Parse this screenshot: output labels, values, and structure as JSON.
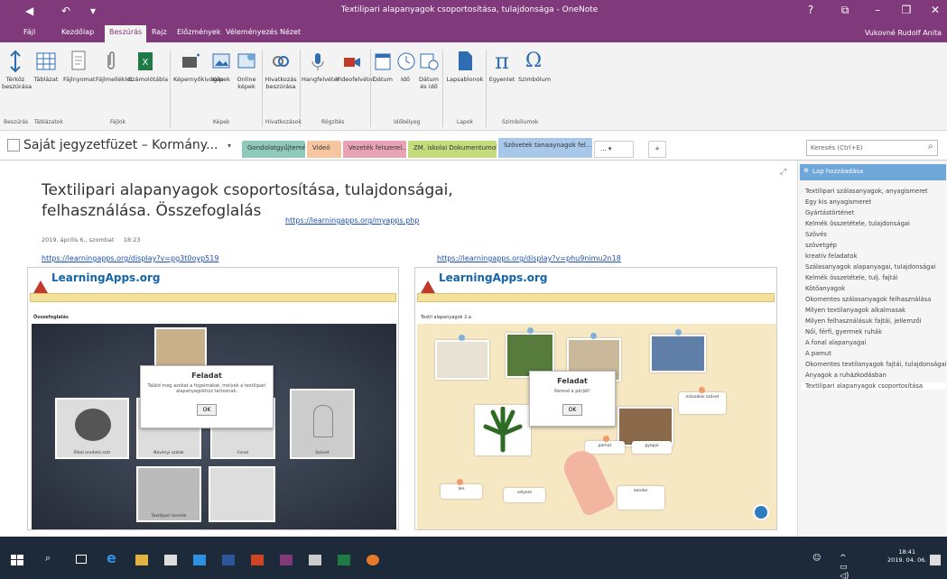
{
  "window": {
    "title": "Textilipari alapanyagok csoportosítása, tulajdonsága - OneNote",
    "controls": [
      "?",
      "⧉",
      "–",
      "❐",
      "✕"
    ]
  },
  "menu": {
    "tabs": [
      "Fájl",
      "Kezdőlap",
      "Beszúrás",
      "Rajz",
      "Előzmények",
      "Véleményezés",
      "Nézet"
    ],
    "active_index": 2,
    "user": "Vukovné Rudolf Anita"
  },
  "ribbon": {
    "buttons": [
      {
        "label": "Térköz beszúrása",
        "icon": "space-icon"
      },
      {
        "label": "Táblázat",
        "icon": "table-icon"
      },
      {
        "label": "Fájlnyomat",
        "icon": "file-printout-icon"
      },
      {
        "label": "Fájlmelléklet",
        "icon": "attachment-icon"
      },
      {
        "label": "Számolótábla",
        "icon": "spreadsheet-icon"
      },
      {
        "label": "Képernyőkivágás",
        "icon": "screen-clipping-icon"
      },
      {
        "label": "Képek",
        "icon": "pictures-icon"
      },
      {
        "label": "Online képek",
        "icon": "online-pictures-icon"
      },
      {
        "label": "Hivatkozás beszúrása",
        "icon": "link-icon"
      },
      {
        "label": "Hangfelvétel",
        "icon": "audio-icon"
      },
      {
        "label": "Videofelvétel",
        "icon": "video-icon"
      },
      {
        "label": "Dátum",
        "icon": "date-icon"
      },
      {
        "label": "Idő",
        "icon": "time-icon"
      },
      {
        "label": "Dátum és idő",
        "icon": "date-time-icon"
      },
      {
        "label": "Lapsablonok",
        "icon": "page-templates-icon"
      },
      {
        "label": "Egyenlet",
        "icon": "equation-icon"
      },
      {
        "label": "Szimbólum",
        "icon": "symbol-icon"
      }
    ],
    "groups": [
      "Beszúrás",
      "Táblázatok",
      "Fájlok",
      "Képek",
      "Hivatkozások",
      "Rögzítés",
      "Időbélyeg",
      "Lapok",
      "Szimbólumok"
    ]
  },
  "notebook": {
    "title": "Saját jegyzetfüzet – Kormány...",
    "sections": [
      {
        "label": "Gondolatgyűjtemény",
        "color": "#8fc9b9"
      },
      {
        "label": "Videó",
        "color": "#f6c6a0"
      },
      {
        "label": "Vezeték felszerel...",
        "color": "#e8a3b5"
      },
      {
        "label": "ZM. iskolai Dokumentumok",
        "color": "#c5dc7c"
      },
      {
        "label": "Szövetek tanaaynagok fel...",
        "color": "#a7c8e8"
      }
    ],
    "more_label": "...",
    "add_label": "+",
    "search_placeholder": "Keresés (Ctrl+E)"
  },
  "page": {
    "title_line1": "Textilipari alapanyagok csoportosítása, tulajdonságai,",
    "title_line2": "felhasználása. Összefoglalás",
    "date": "2019. április 6., szombat",
    "time": "18:23",
    "link_top": "https://learningapps.org/myapps.php",
    "link_left": "https://learningapps.org/display?v=pg3t0oyp519",
    "link_right": "https://learningapps.org/display?v=phu9nimu2n18"
  },
  "left_app": {
    "logo": "LearningApps.org",
    "heading": "Összefoglalás",
    "dialog_title": "Feladat",
    "dialog_body": "Találd meg azokat a fogalmakat, melyek a textilipari alapanyagokhoz tartoznak.",
    "dialog_ok": "OK",
    "cards": [
      "Állati eredetű szőr",
      "Növényi szálak",
      "Fonal",
      "Szövet",
      "Textilipari termék"
    ]
  },
  "right_app": {
    "logo": "LearningApps.org",
    "heading": "Textil alapanyagok 2.a",
    "dialog_title": "Feladat",
    "dialog_body": "Keresd a párját!",
    "dialog_ok": "OK",
    "labels": [
      "pamut",
      "gyapjú",
      "len",
      "selyem",
      "kender",
      "műszálas szövet"
    ]
  },
  "pages_pane": {
    "add_label": "Lap hozzáadása",
    "items": [
      "Textilipari szálasanyagok, anyagismeret",
      "Egy kis anyagismeret",
      "Gyártástörténet",
      "Kelmék összetétele, tulajdonságai",
      "Szövés",
      "szövetgép",
      "kreatív feladatok",
      "Szálasanyagok alapanyagai, tulajdonságai",
      "Kelmék összetétele, tulj. fajtái",
      "Kötőanyagok",
      "Ökomentes szálasanyagok felhasználása",
      "Milyen textilanyagok alkalmasak",
      "Milyen felhasználásuk fajtái, jellemzői",
      "Női, férfi, gyermek ruhák",
      "A fonal alapanyagai",
      "A pamut",
      "Ökomentes textilanyagok fajtái, tulajdonságai",
      "Anyagok a ruházkodásban",
      "Textilipari alapanyagok csoportosítása"
    ],
    "selected_index": 18
  },
  "taskbar": {
    "time": "18:41",
    "date": "2019. 04. 06."
  }
}
